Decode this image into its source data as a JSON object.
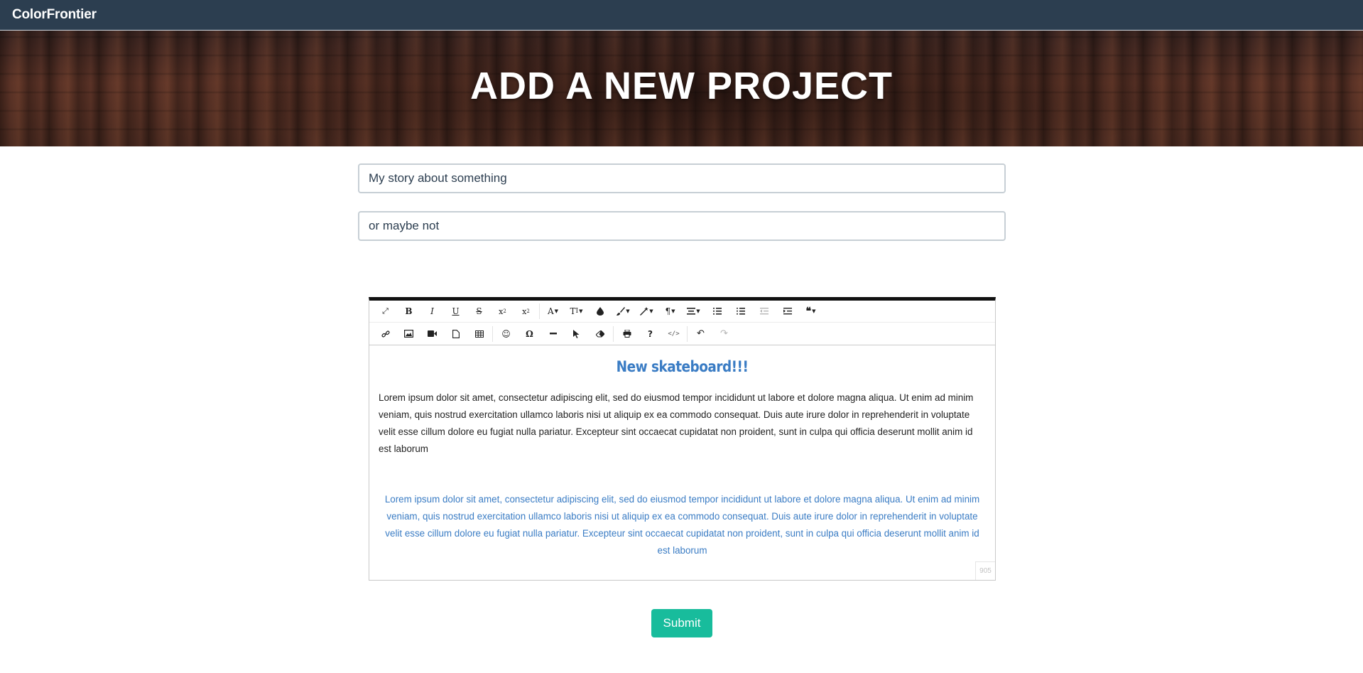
{
  "navbar": {
    "brand": "ColorFrontier"
  },
  "hero": {
    "title": "ADD A NEW PROJECT"
  },
  "form": {
    "title_value": "My story about something",
    "subtitle_value": "or maybe not",
    "submit_label": "Submit"
  },
  "editor": {
    "toolbar_row1": [
      {
        "name": "fullscreen-icon",
        "glyph": "⤢"
      },
      {
        "name": "bold-icon",
        "glyph": "B"
      },
      {
        "name": "italic-icon",
        "glyph": "I"
      },
      {
        "name": "underline-icon",
        "glyph": "U"
      },
      {
        "name": "strikethrough-icon",
        "glyph": "S"
      },
      {
        "name": "subscript-icon",
        "glyph": "x₂"
      },
      {
        "name": "superscript-icon",
        "glyph": "x²"
      },
      {
        "name": "font-family-icon",
        "glyph": "A"
      },
      {
        "name": "font-size-icon",
        "glyph": "TI"
      },
      {
        "name": "color-icon",
        "glyph": "💧"
      },
      {
        "name": "brush-icon",
        "glyph": "🖌"
      },
      {
        "name": "magic-icon",
        "glyph": "✎"
      },
      {
        "name": "paragraph-icon",
        "glyph": "¶"
      },
      {
        "name": "align-icon",
        "glyph": "☰"
      },
      {
        "name": "ordered-list-icon",
        "glyph": "⒈"
      },
      {
        "name": "unordered-list-icon",
        "glyph": "•"
      },
      {
        "name": "outdent-icon",
        "glyph": "⇤"
      },
      {
        "name": "indent-icon",
        "glyph": "⇥"
      },
      {
        "name": "quote-icon",
        "glyph": "❝"
      }
    ],
    "toolbar_row2": [
      {
        "name": "link-icon",
        "glyph": "🔗"
      },
      {
        "name": "image-icon",
        "glyph": "▣"
      },
      {
        "name": "video-icon",
        "glyph": "■"
      },
      {
        "name": "file-icon",
        "glyph": "▢"
      },
      {
        "name": "table-icon",
        "glyph": "▦"
      },
      {
        "name": "emoji-icon",
        "glyph": "☺"
      },
      {
        "name": "special-char-icon",
        "glyph": "Ω"
      },
      {
        "name": "horizontal-rule-icon",
        "glyph": "—"
      },
      {
        "name": "select-icon",
        "glyph": "➤"
      },
      {
        "name": "eraser-icon",
        "glyph": "⌫"
      },
      {
        "name": "print-icon",
        "glyph": "⎙"
      },
      {
        "name": "help-icon",
        "glyph": "?"
      },
      {
        "name": "code-view-icon",
        "glyph": "</>"
      },
      {
        "name": "undo-icon",
        "glyph": "↶"
      },
      {
        "name": "redo-icon",
        "glyph": "↷"
      }
    ],
    "heading": "New skateboard!!!",
    "paragraph1": "Lorem ipsum dolor sit amet, consectetur adipiscing elit, sed do eiusmod tempor incididunt ut labore et dolore magna aliqua. Ut enim ad minim veniam, quis nostrud exercitation ullamco laboris nisi ut aliquip ex ea commodo consequat. Duis aute irure dolor in reprehenderit in voluptate velit esse cillum dolore eu fugiat nulla pariatur. Excepteur sint occaecat cupidatat non proident, sunt in culpa qui officia deserunt mollit anim id est laborum",
    "paragraph2": "Lorem ipsum dolor sit amet, consectetur adipiscing elit, sed do eiusmod tempor incididunt ut labore et dolore magna aliqua. Ut enim ad minim veniam, quis nostrud exercitation ullamco laboris nisi ut aliquip ex ea commodo consequat. Duis aute irure dolor in reprehenderit in voluptate velit esse cillum dolore eu fugiat nulla pariatur. Excepteur sint occaecat cupidatat non proident, sunt in culpa qui officia deserunt mollit anim id est laborum",
    "char_count": "905"
  },
  "colors": {
    "navbar": "#2c3e50",
    "accent": "#18bc9c",
    "heading_blue": "#3a7cc4"
  }
}
